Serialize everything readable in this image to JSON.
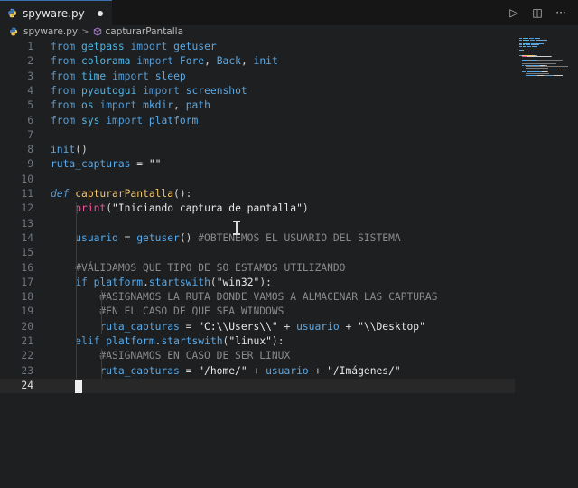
{
  "tab": {
    "filename": "spyware.py",
    "icon": "python-icon",
    "modified": true
  },
  "actions": [
    {
      "name": "run-button",
      "icon": "play-icon",
      "glyph": "▷"
    },
    {
      "name": "split-editor-button",
      "icon": "split-icon",
      "glyph": "◫"
    },
    {
      "name": "more-actions-button",
      "icon": "ellipsis-icon",
      "glyph": "···"
    }
  ],
  "breadcrumb": {
    "file": "spyware.py",
    "symbol": "capturarPantalla",
    "separator": ">"
  },
  "editor": {
    "current_line": 24,
    "lines": [
      {
        "n": "1",
        "tokens": [
          [
            "kw",
            "from"
          ],
          [
            "plain",
            " "
          ],
          [
            "mod",
            "getpass"
          ],
          [
            "plain",
            " "
          ],
          [
            "kw",
            "import"
          ],
          [
            "plain",
            " "
          ],
          [
            "ident",
            "getuser"
          ]
        ]
      },
      {
        "n": "2",
        "tokens": [
          [
            "kw",
            "from"
          ],
          [
            "plain",
            " "
          ],
          [
            "mod",
            "colorama"
          ],
          [
            "plain",
            " "
          ],
          [
            "kw",
            "import"
          ],
          [
            "plain",
            " "
          ],
          [
            "ident",
            "Fore"
          ],
          [
            "plain",
            ", "
          ],
          [
            "ident",
            "Back"
          ],
          [
            "plain",
            ", "
          ],
          [
            "ident",
            "init"
          ]
        ]
      },
      {
        "n": "3",
        "tokens": [
          [
            "kw",
            "from"
          ],
          [
            "plain",
            " "
          ],
          [
            "mod",
            "time"
          ],
          [
            "plain",
            " "
          ],
          [
            "kw",
            "import"
          ],
          [
            "plain",
            " "
          ],
          [
            "ident",
            "sleep"
          ]
        ]
      },
      {
        "n": "4",
        "tokens": [
          [
            "kw",
            "from"
          ],
          [
            "plain",
            " "
          ],
          [
            "mod",
            "pyautogui"
          ],
          [
            "plain",
            " "
          ],
          [
            "kw",
            "import"
          ],
          [
            "plain",
            " "
          ],
          [
            "ident",
            "screenshot"
          ]
        ]
      },
      {
        "n": "5",
        "tokens": [
          [
            "kw",
            "from"
          ],
          [
            "plain",
            " "
          ],
          [
            "mod",
            "os"
          ],
          [
            "plain",
            " "
          ],
          [
            "kw",
            "import"
          ],
          [
            "plain",
            " "
          ],
          [
            "ident",
            "mkdir"
          ],
          [
            "plain",
            ", "
          ],
          [
            "ident",
            "path"
          ]
        ]
      },
      {
        "n": "6",
        "tokens": [
          [
            "kw",
            "from"
          ],
          [
            "plain",
            " "
          ],
          [
            "mod",
            "sys"
          ],
          [
            "plain",
            " "
          ],
          [
            "kw",
            "import"
          ],
          [
            "plain",
            " "
          ],
          [
            "ident",
            "platform"
          ]
        ]
      },
      {
        "n": "7",
        "tokens": []
      },
      {
        "n": "8",
        "tokens": [
          [
            "ident",
            "init"
          ],
          [
            "plain",
            "()"
          ]
        ]
      },
      {
        "n": "9",
        "tokens": [
          [
            "ident",
            "ruta_capturas"
          ],
          [
            "plain",
            " = "
          ],
          [
            "str",
            "\"\""
          ]
        ]
      },
      {
        "n": "10",
        "tokens": []
      },
      {
        "n": "11",
        "tokens": [
          [
            "kwi",
            "def"
          ],
          [
            "plain",
            " "
          ],
          [
            "fn",
            "capturarPantalla"
          ],
          [
            "plain",
            "():"
          ]
        ]
      },
      {
        "n": "12",
        "tokens": [
          [
            "plain",
            "    "
          ],
          [
            "bi",
            "print"
          ],
          [
            "plain",
            "("
          ],
          [
            "str",
            "\"Iniciando captura de pantalla\""
          ],
          [
            "plain",
            ")"
          ]
        ]
      },
      {
        "n": "13",
        "tokens": []
      },
      {
        "n": "14",
        "tokens": [
          [
            "plain",
            "    "
          ],
          [
            "ident",
            "usuario"
          ],
          [
            "plain",
            " = "
          ],
          [
            "ident",
            "getuser"
          ],
          [
            "plain",
            "() "
          ],
          [
            "cmt",
            "#OBTENEMOS EL USUARIO DEL SISTEMA"
          ]
        ]
      },
      {
        "n": "15",
        "tokens": []
      },
      {
        "n": "16",
        "tokens": [
          [
            "plain",
            "    "
          ],
          [
            "cmt",
            "#VÁLIDAMOS QUE TIPO DE SO ESTAMOS UTILIZANDO"
          ]
        ]
      },
      {
        "n": "17",
        "tokens": [
          [
            "plain",
            "    "
          ],
          [
            "kw",
            "if"
          ],
          [
            "plain",
            " "
          ],
          [
            "ident",
            "platform"
          ],
          [
            "plain",
            "."
          ],
          [
            "ident",
            "startswith"
          ],
          [
            "plain",
            "("
          ],
          [
            "str",
            "\"win32\""
          ],
          [
            "plain",
            "):"
          ]
        ]
      },
      {
        "n": "18",
        "tokens": [
          [
            "plain",
            "        "
          ],
          [
            "cmt",
            "#ASIGNAMOS LA RUTA DONDE VAMOS A ALMACENAR LAS CAPTURAS"
          ]
        ]
      },
      {
        "n": "19",
        "tokens": [
          [
            "plain",
            "        "
          ],
          [
            "cmt",
            "#EN EL CASO DE QUE SEA WINDOWS"
          ]
        ]
      },
      {
        "n": "20",
        "tokens": [
          [
            "plain",
            "        "
          ],
          [
            "ident",
            "ruta_capturas"
          ],
          [
            "plain",
            " = "
          ],
          [
            "str",
            "\"C:\\\\Users\\\\\""
          ],
          [
            "plain",
            " + "
          ],
          [
            "ident",
            "usuario"
          ],
          [
            "plain",
            " + "
          ],
          [
            "str",
            "\"\\\\Desktop\""
          ]
        ]
      },
      {
        "n": "21",
        "tokens": [
          [
            "plain",
            "    "
          ],
          [
            "kw",
            "elif"
          ],
          [
            "plain",
            " "
          ],
          [
            "ident",
            "platform"
          ],
          [
            "plain",
            "."
          ],
          [
            "ident",
            "startswith"
          ],
          [
            "plain",
            "("
          ],
          [
            "str",
            "\"linux\""
          ],
          [
            "plain",
            "):"
          ]
        ]
      },
      {
        "n": "22",
        "tokens": [
          [
            "plain",
            "        "
          ],
          [
            "cmt",
            "#ASIGNAMOS EN CASO DE SER LINUX"
          ]
        ]
      },
      {
        "n": "23",
        "tokens": [
          [
            "plain",
            "        "
          ],
          [
            "ident",
            "ruta_capturas"
          ],
          [
            "plain",
            " = "
          ],
          [
            "str",
            "\"/home/\""
          ],
          [
            "plain",
            " + "
          ],
          [
            "ident",
            "usuario"
          ],
          [
            "plain",
            " + "
          ],
          [
            "str",
            "\"/Imágenes/\""
          ]
        ]
      },
      {
        "n": "24",
        "tokens": []
      }
    ]
  },
  "colors": {
    "keyword": "#569cd6",
    "function": "#f2c46d",
    "builtin": "#e65a9c",
    "comment": "#8a8a8a",
    "string": "#e8e8e8",
    "tab_accent": "#3a6fb0"
  }
}
